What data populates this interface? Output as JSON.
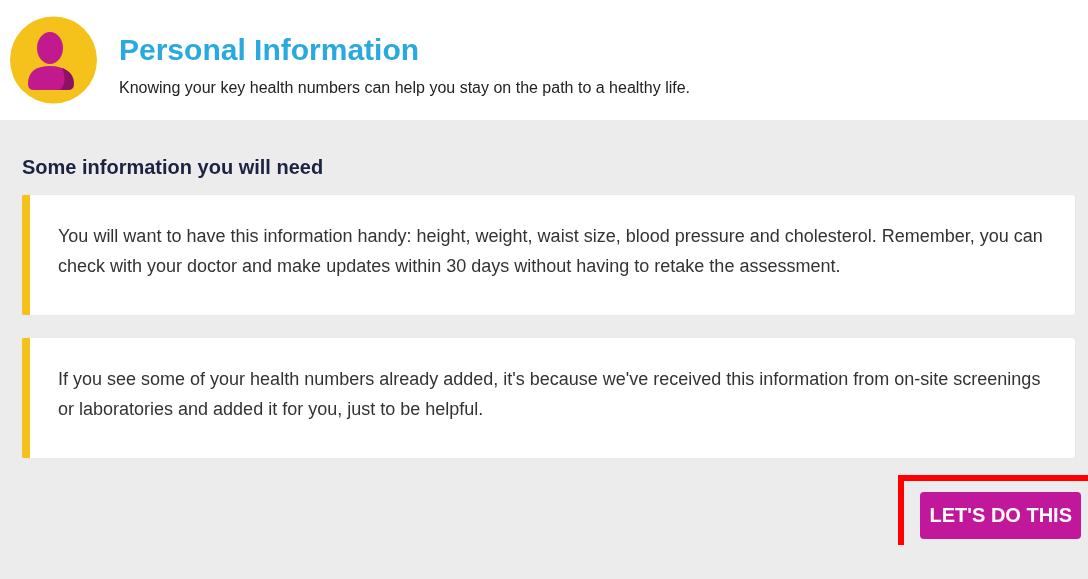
{
  "header": {
    "title": "Personal Information",
    "subtitle": "Knowing your key health numbers can help you stay on the path to a healthy life."
  },
  "section": {
    "heading": "Some information you will need",
    "notes": [
      "You will want to have this information handy: height, weight, waist size, blood pressure and cholesterol. Remember, you can check with your doctor and make updates within 30 days without having to retake the assessment.",
      "If you see some of your health numbers already added, it's because we've received this information from on-site screenings or laboratories and added it for you, just to be helpful."
    ]
  },
  "button": {
    "label": "LET'S DO THIS",
    "highlighted": true
  }
}
